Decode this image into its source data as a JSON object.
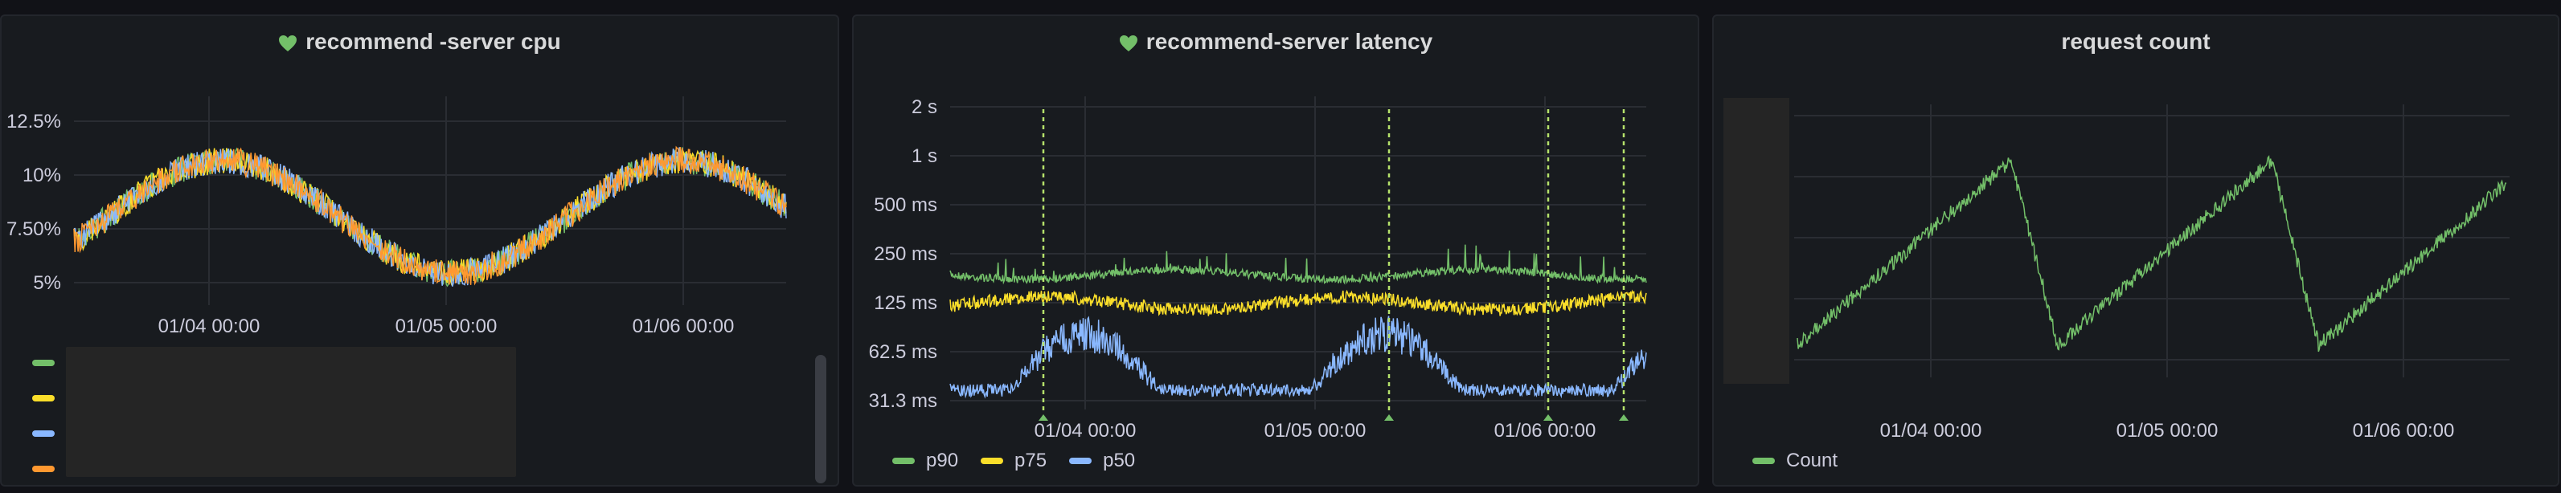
{
  "panels": {
    "cpu": {
      "title": "recommend -server cpu",
      "icon": "heart-icon",
      "y_ticks": [
        "12.5%",
        "10%",
        "7.50%",
        "5%"
      ],
      "x_ticks": [
        "01/04 00:00",
        "01/05 00:00",
        "01/06 00:00"
      ],
      "series_colors": [
        "#73bf69",
        "#fade2a",
        "#8ab8ff",
        "#ff9830"
      ]
    },
    "latency": {
      "title": "recommend-server latency",
      "icon": "heart-icon",
      "y_ticks": [
        "2 s",
        "1 s",
        "500 ms",
        "250 ms",
        "125 ms",
        "62.5 ms",
        "31.3 ms"
      ],
      "x_ticks": [
        "01/04 00:00",
        "01/05 00:00",
        "01/06 00:00"
      ],
      "legend": [
        {
          "name": "p90",
          "color": "#73bf69"
        },
        {
          "name": "p75",
          "color": "#fade2a"
        },
        {
          "name": "p50",
          "color": "#8ab8ff"
        }
      ]
    },
    "requests": {
      "title": "request count",
      "x_ticks": [
        "01/04 00:00",
        "01/05 00:00",
        "01/06 00:00"
      ],
      "legend": [
        {
          "name": "Count",
          "color": "#73bf69"
        }
      ]
    }
  }
}
